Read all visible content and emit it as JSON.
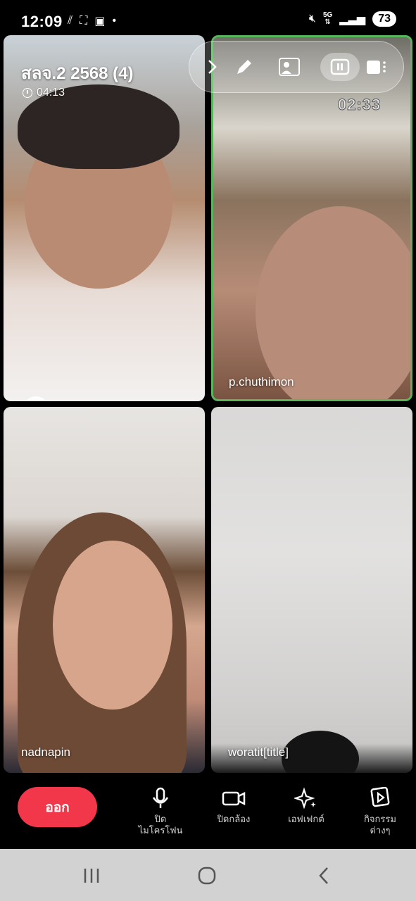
{
  "status": {
    "time": "12:09",
    "network": "5G",
    "battery": "73"
  },
  "call": {
    "group_title": "สลจ.2 2568 (4)",
    "call_duration": "04:13",
    "recording_time": "02:33"
  },
  "participants": [
    {
      "name": ""
    },
    {
      "name": "p.chuthimon"
    },
    {
      "name": "nadnapin"
    },
    {
      "name": "woratit[title]"
    }
  ],
  "controls": {
    "leave": "ออก",
    "mic": "ปิด\nไมโครโฟน",
    "camera": "ปิดกล้อง",
    "effects": "เอฟเฟกต์",
    "activities": "กิจกรรม\nต่างๆ"
  },
  "colors": {
    "leave_button": "#f2374b",
    "active_speaker_border": "#57b65a"
  }
}
